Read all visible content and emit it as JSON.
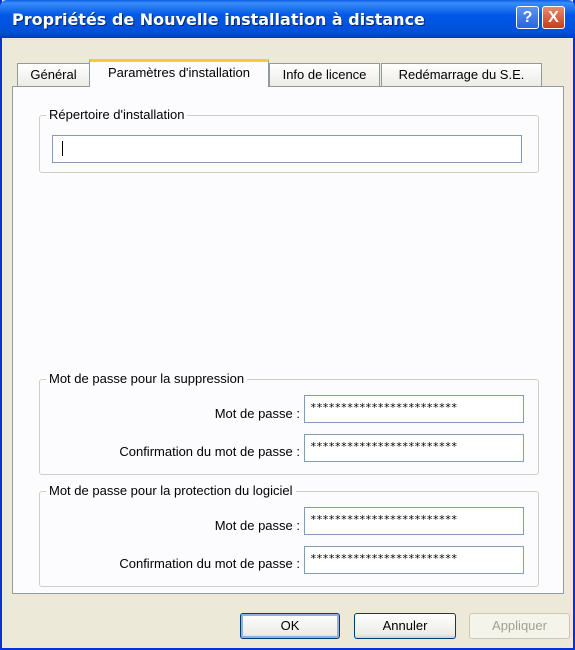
{
  "window": {
    "title": "Propriétés de Nouvelle installation à distance",
    "help_label": "?",
    "close_label": "X"
  },
  "tabs": [
    {
      "label": "Général",
      "active": false
    },
    {
      "label": "Paramètres d'installation",
      "active": true
    },
    {
      "label": "Info de licence",
      "active": false
    },
    {
      "label": "Redémarrage du S.E.",
      "active": false
    }
  ],
  "install_dir": {
    "legend": "Répertoire d'installation",
    "value": ""
  },
  "removal_password": {
    "legend": "Mot de passe pour la suppression",
    "password_label": "Mot de passe :",
    "password_value": "************************",
    "confirm_label": "Confirmation du mot de passe :",
    "confirm_value": "************************"
  },
  "protection_password": {
    "legend": "Mot de passe pour la protection du logiciel",
    "password_label": "Mot de passe :",
    "password_value": "************************",
    "confirm_label": "Confirmation du mot de passe :",
    "confirm_value": "************************"
  },
  "buttons": {
    "ok": "OK",
    "cancel": "Annuler",
    "apply": "Appliquer"
  }
}
